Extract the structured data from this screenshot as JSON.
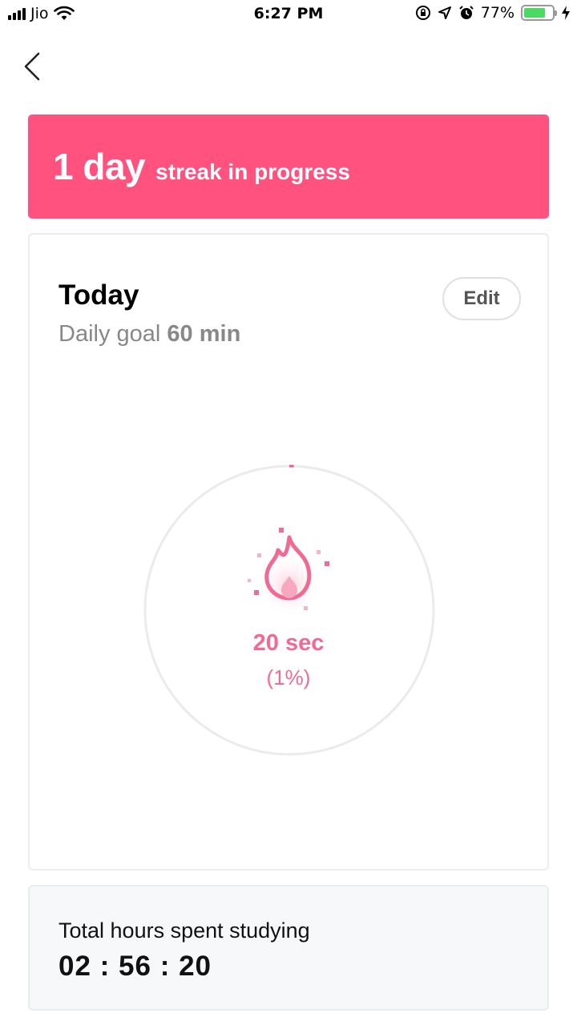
{
  "status_bar": {
    "carrier": "Jio",
    "time": "6:27 PM",
    "battery_percent": "77%",
    "battery_level": 0.77,
    "icons": [
      "signal-icon",
      "wifi-icon",
      "orientation-lock-icon",
      "location-icon",
      "alarm-icon",
      "battery-icon",
      "charging-icon"
    ]
  },
  "nav": {
    "back_icon": "chevron-left-icon"
  },
  "streak": {
    "count": "1 day",
    "label": "streak in progress",
    "color": "#ff527f"
  },
  "today": {
    "title": "Today",
    "goal_prefix": "Daily goal",
    "goal_value": "60 min",
    "edit_label": "Edit",
    "progress_time": "20 sec",
    "progress_percent": "(1%)",
    "progress_fraction": 0.01,
    "accent_color": "#f06a92",
    "icon": "flame-icon"
  },
  "total": {
    "label": "Total hours spent studying",
    "value": "02 : 56 : 20"
  }
}
